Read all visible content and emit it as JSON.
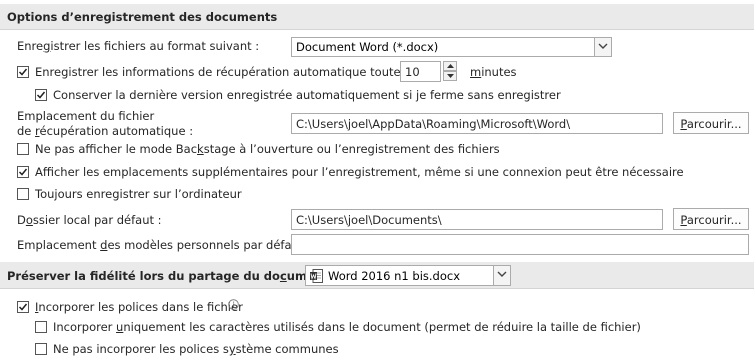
{
  "save_section": {
    "title": "Options d’enregistrement des documents",
    "format": {
      "label_pre": "Enre",
      "label_u": "g",
      "label_post": "istrer les fichiers au format suivant :",
      "value": "Document Word (*.docx)"
    },
    "autorecover": {
      "checked": true,
      "label_pre": "Enregistrer les informations de récupération automatique toutes les",
      "minutes_value": "10",
      "unit_u": "m",
      "unit_post": "inutes"
    },
    "keep_last": {
      "checked": true,
      "label": "Conserver la dernière version enregistrée automatiquement si je ferme sans enregistrer"
    },
    "autorecover_location": {
      "label_line1": "Emplacement du fichier",
      "label_line2_pre": "de ",
      "label_line2_u": "r",
      "label_line2_post": "écupération automatique :",
      "value": "C:\\Users\\joel\\AppData\\Roaming\\Microsoft\\Word\\",
      "browse_pre": "",
      "browse_u": "P",
      "browse_post": "arcourir..."
    },
    "no_backstage": {
      "checked": false,
      "label_pre": "Ne pas afficher le mode Bac",
      "label_u": "k",
      "label_post": "stage à l’ouverture ou l’enregistrement des fichiers"
    },
    "show_locations": {
      "checked": true,
      "label_pre": "Afficher les emplacements supplémentaires pour l’enregistrement, même si une connexion peut être nécessaire"
    },
    "always_local": {
      "checked": false,
      "label_pre": "Toujours enregistrer sur l’ordinateur"
    },
    "default_local": {
      "label_pre": "D",
      "label_u": "o",
      "label_post": "ssier local par défaut :",
      "value": "C:\\Users\\joel\\Documents\\",
      "browse_u": "P",
      "browse_post": "arcourir..."
    },
    "templates_location": {
      "label_pre": "Emplacement ",
      "label_u": "d",
      "label_post": "es modèles personnels par défaut :",
      "value": ""
    }
  },
  "fidelity_section": {
    "title_pre": "Préserver la fidélité lors du partage du do",
    "title_u": "c",
    "title_post": "ument :",
    "document": "Word 2016 n1 bis.docx",
    "doc_icon": "word-document-icon",
    "embed_fonts": {
      "checked": true,
      "label_u": "I",
      "label_post": "ncorporer les polices dans le fichier",
      "info_icon": "info-icon"
    },
    "embed_used_only": {
      "checked": false,
      "label_pre": "Incorporer ",
      "label_u": "u",
      "label_post": "niquement les caractères utilisés dans le document (permet de réduire la taille de fichier)"
    },
    "no_system_fonts": {
      "checked": false,
      "label_pre": "Ne pas incorporer les polices s",
      "label_u": "y",
      "label_post": "stème communes"
    }
  }
}
